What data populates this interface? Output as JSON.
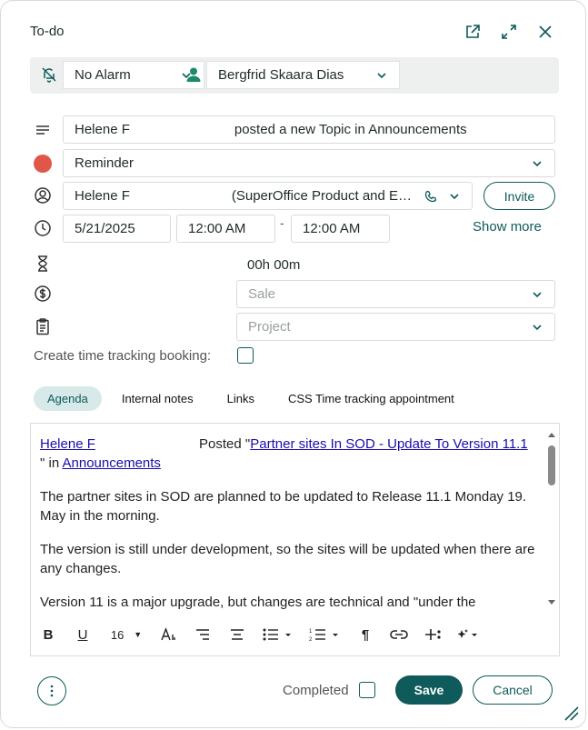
{
  "header": {
    "title": "To-do"
  },
  "top_row": {
    "alarm_label": "No Alarm",
    "owner_label": "Bergfrid Skaara Dias"
  },
  "form": {
    "subject_prefix": "Helene F",
    "subject_suffix": "posted a new Topic in  Announcements",
    "type_label": "Reminder",
    "contact_prefix": "Helene F",
    "contact_suffix": "(SuperOffice Product and E…",
    "invite_label": "Invite",
    "date": "5/21/2025",
    "start_time": "12:00 AM",
    "time_separator": "-",
    "end_time": "12:00 AM",
    "show_more_label": "Show more",
    "duration": "00h 00m",
    "sale_placeholder": "Sale",
    "project_placeholder": "Project",
    "time_tracking_label": "Create time tracking booking:"
  },
  "tabs": [
    {
      "label": "Agenda",
      "active": true
    },
    {
      "label": "Internal notes",
      "active": false
    },
    {
      "label": "Links",
      "active": false
    },
    {
      "label": "CSS Time tracking appointment",
      "active": false
    }
  ],
  "editor": {
    "author": "Helene F",
    "posted_text": "Posted \"",
    "link_title": "Partner sites In SOD - Update To Version 11.1 ",
    "after_link": "\" in ",
    "forum_link": "Announcements",
    "para1": "The partner sites in SOD are planned to be updated to Release 11.1 Monday 19. May in the morning.",
    "para2": "The version is still under development, so the sites will be updated when there are any changes.",
    "para3": "Version 11 is a major upgrade, but changes are technical and \"under the",
    "toolbar": {
      "font_size": "16"
    }
  },
  "footer": {
    "completed_label": "Completed",
    "save_label": "Save",
    "cancel_label": "Cancel"
  },
  "colors": {
    "accent": "#0f5a5a",
    "reminder_dot": "#e0574a",
    "active_tab_bg": "#d7e9e8",
    "link": "#1a0dab"
  }
}
